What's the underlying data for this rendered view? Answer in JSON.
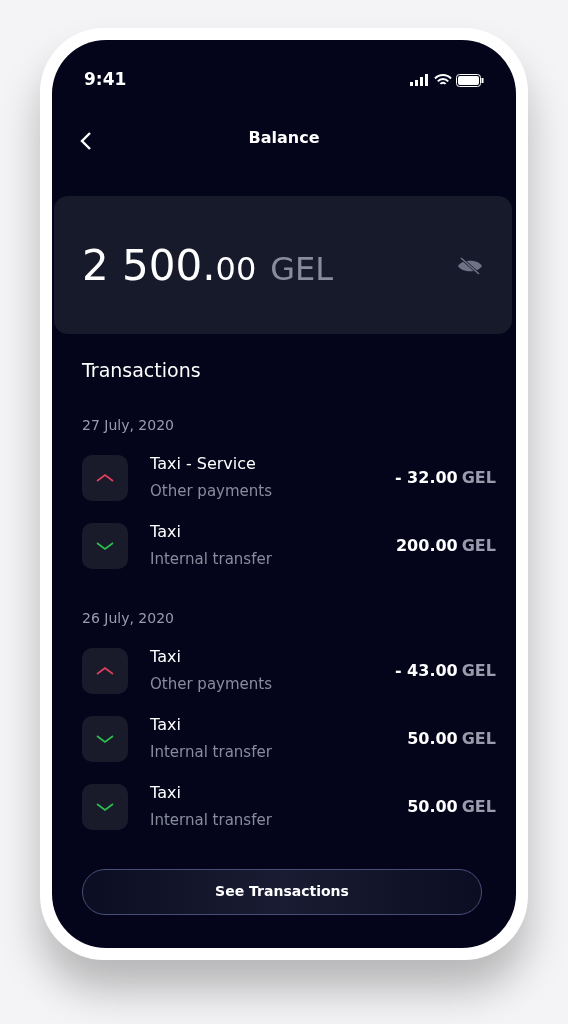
{
  "status_bar": {
    "time": "9:41"
  },
  "header": {
    "title": "Balance"
  },
  "balance": {
    "integer": "2 500.",
    "decimals": "00",
    "currency": "GEL"
  },
  "transactions": {
    "title": "Transactions",
    "groups": [
      {
        "date": "27 July, 2020",
        "items": [
          {
            "kind": "outgoing",
            "title": "Taxi - Service",
            "subtitle": "Other payments",
            "amount": "- 32.00",
            "currency": "GEL"
          },
          {
            "kind": "incoming",
            "title": "Taxi",
            "subtitle": "Internal transfer",
            "amount": "200.00",
            "currency": "GEL"
          }
        ]
      },
      {
        "date": "26 July, 2020",
        "items": [
          {
            "kind": "outgoing",
            "title": "Taxi",
            "subtitle": "Other payments",
            "amount": "- 43.00",
            "currency": "GEL"
          },
          {
            "kind": "incoming",
            "title": "Taxi",
            "subtitle": "Internal transfer",
            "amount": "50.00",
            "currency": "GEL"
          },
          {
            "kind": "incoming",
            "title": "Taxi",
            "subtitle": "Internal transfer",
            "amount": "50.00",
            "currency": "GEL"
          }
        ]
      }
    ]
  },
  "button": {
    "label": "See Transactions"
  }
}
